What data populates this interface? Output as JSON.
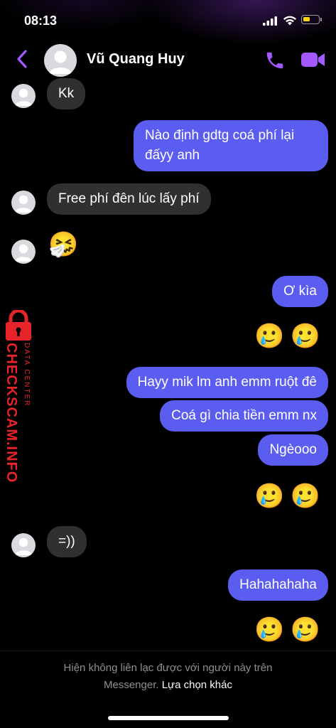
{
  "status_bar": {
    "time": "08:13",
    "battery_color": "#ffd60a"
  },
  "header": {
    "contact_name": "Vũ Quang Huy",
    "back_icon": "chevron-left-icon",
    "call_icon": "phone-icon",
    "video_icon": "video-camera-icon",
    "accent_color": "#a259ff"
  },
  "messages": [
    {
      "side": "in",
      "text": "Kk"
    },
    {
      "side": "out",
      "text": "Nào định gdtg coá phí lại đấyy anh"
    },
    {
      "side": "in",
      "text": "Free phí đên lúc  lấy phí"
    },
    {
      "side": "in",
      "emoji": "🤧"
    },
    {
      "side": "out",
      "text": "Ơ kìa"
    },
    {
      "side": "out",
      "emoji": "🥲🥲"
    },
    {
      "side": "out",
      "text": "Hayy mik lm anh emm ruột đê"
    },
    {
      "side": "out",
      "text": "Coá gì chia tiền emm nx"
    },
    {
      "side": "out",
      "text": "Ngèooo"
    },
    {
      "side": "out",
      "emoji": "🥲🥲"
    },
    {
      "side": "in",
      "text": "=))"
    },
    {
      "side": "out",
      "text": "Hahahahaha"
    },
    {
      "side": "out",
      "emoji": "🥲🥲"
    }
  ],
  "bubble_colors": {
    "incoming": "#303030",
    "outgoing": "#5b5cf0"
  },
  "watermark": {
    "main": "CHECKSCAM.INFO",
    "sub": "DATA CENTER",
    "color": "#e8232a"
  },
  "footer": {
    "notice": "Hiện không liên lạc được với người này trên",
    "notice_line2": "Messenger.",
    "link": "Lựa chọn khác"
  }
}
